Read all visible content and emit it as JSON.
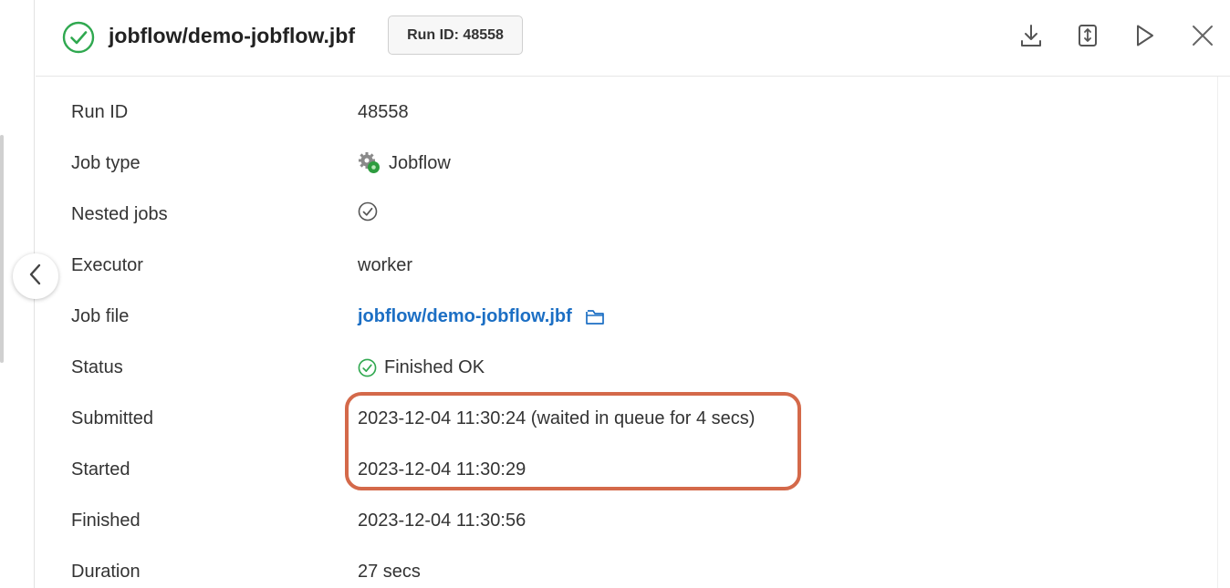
{
  "header": {
    "title": "jobflow/demo-jobflow.jbf",
    "run_id_badge": "Run ID: 48558",
    "status_color": "#2fa84f",
    "actions": [
      {
        "name": "download-icon"
      },
      {
        "name": "document-icon"
      },
      {
        "name": "play-icon"
      },
      {
        "name": "close-icon"
      }
    ]
  },
  "details": {
    "run_id": {
      "label": "Run ID",
      "value": "48558"
    },
    "job_type": {
      "label": "Job type",
      "value": "Jobflow",
      "icon": "jobflow-gear-icon"
    },
    "nested_jobs": {
      "label": "Nested jobs",
      "icon": "check-circle-icon"
    },
    "executor": {
      "label": "Executor",
      "value": "worker"
    },
    "job_file": {
      "label": "Job file",
      "value": "jobflow/demo-jobflow.jbf",
      "icon": "open-in-new-icon"
    },
    "status": {
      "label": "Status",
      "value": "Finished OK",
      "icon": "check-circle-icon"
    },
    "submitted": {
      "label": "Submitted",
      "value": "2023-12-04 11:30:24 (waited in queue for 4 secs)"
    },
    "started": {
      "label": "Started",
      "value": "2023-12-04 11:30:29"
    },
    "finished": {
      "label": "Finished",
      "value": "2023-12-04 11:30:56"
    },
    "duration": {
      "label": "Duration",
      "value": "27 secs"
    }
  },
  "colors": {
    "link": "#1c6fc4",
    "highlight": "#d4694a",
    "success": "#2fa84f"
  }
}
